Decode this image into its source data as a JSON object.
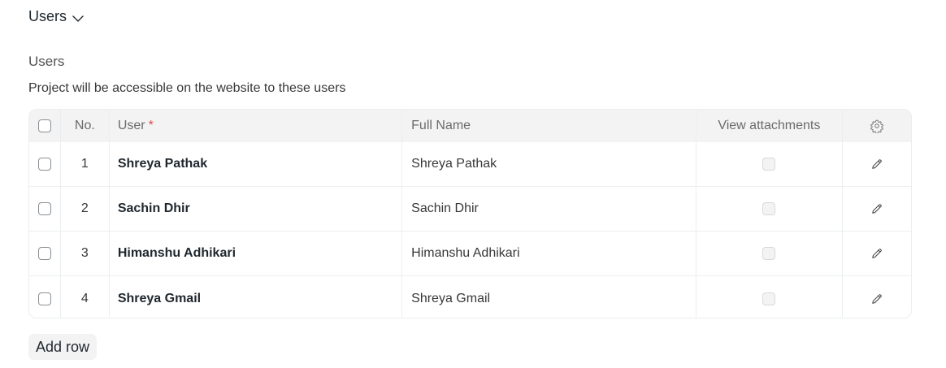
{
  "section": {
    "title": "Users",
    "chevron_icon": "chevron-down-icon"
  },
  "field": {
    "label": "Users",
    "description": "Project will be accessible on the website to these users"
  },
  "table": {
    "headers": {
      "no": "No.",
      "user": "User",
      "required_mark": "*",
      "full_name": "Full Name",
      "view_attachments": "View attachments",
      "settings_icon": "gear-icon"
    },
    "rows": [
      {
        "no": "1",
        "user": "Shreya Pathak",
        "full_name": "Shreya Pathak",
        "view_attachments": false
      },
      {
        "no": "2",
        "user": "Sachin Dhir",
        "full_name": "Sachin Dhir",
        "view_attachments": false
      },
      {
        "no": "3",
        "user": "Himanshu Adhikari",
        "full_name": "Himanshu Adhikari",
        "view_attachments": false
      },
      {
        "no": "4",
        "user": "Shreya Gmail",
        "full_name": "Shreya Gmail",
        "view_attachments": false
      }
    ],
    "row_action_icon": "edit-pencil-icon"
  },
  "add_row_label": "Add row",
  "colors": {
    "header_bg": "#f3f3f3",
    "border": "#ebeef0",
    "required": "#e24c4c",
    "text": "#1f272e"
  }
}
